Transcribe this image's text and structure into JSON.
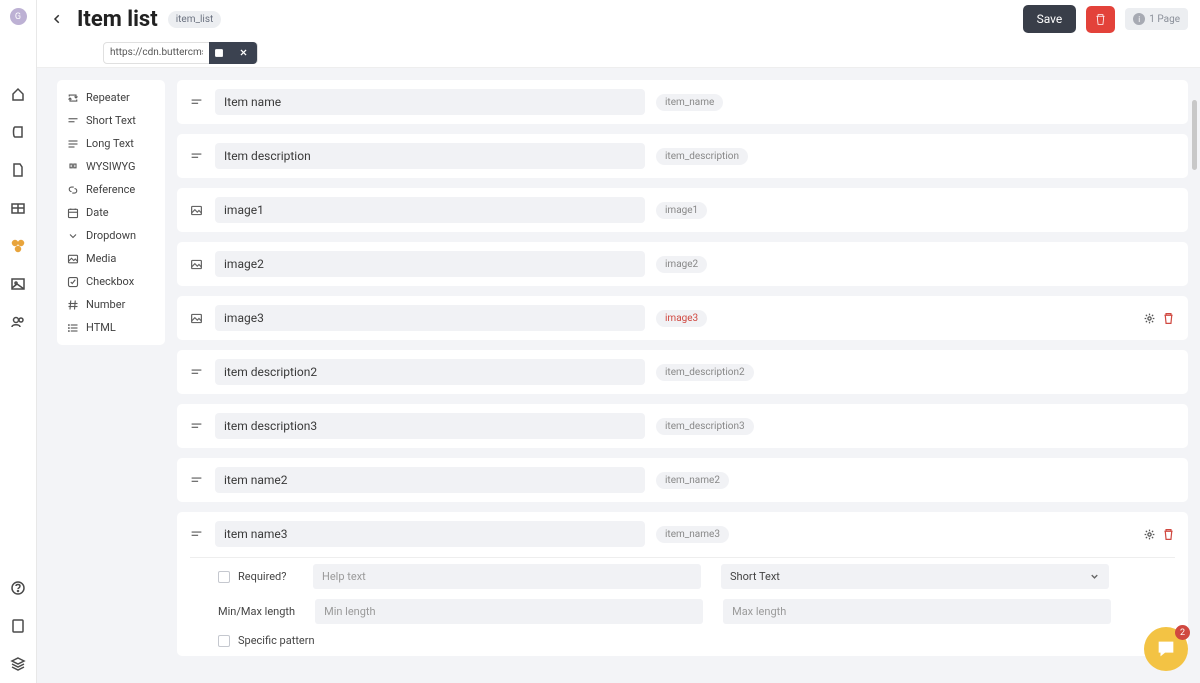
{
  "avatar_initial": "G",
  "header": {
    "title": "Item list",
    "slug": "item_list",
    "save_label": "Save",
    "page_info": "1 Page",
    "url_value": "https://cdn.buttercms."
  },
  "palette": [
    {
      "label": "Repeater",
      "icon": "repeat"
    },
    {
      "label": "Short Text",
      "icon": "short"
    },
    {
      "label": "Long Text",
      "icon": "long"
    },
    {
      "label": "WYSIWYG",
      "icon": "quote"
    },
    {
      "label": "Reference",
      "icon": "link"
    },
    {
      "label": "Date",
      "icon": "cal"
    },
    {
      "label": "Dropdown",
      "icon": "chev"
    },
    {
      "label": "Media",
      "icon": "img"
    },
    {
      "label": "Checkbox",
      "icon": "check"
    },
    {
      "label": "Number",
      "icon": "hash"
    },
    {
      "label": "HTML",
      "icon": "list"
    }
  ],
  "fields": [
    {
      "name": "Item name",
      "slug": "item_name",
      "type": "short"
    },
    {
      "name": "Item description",
      "slug": "item_description",
      "type": "short"
    },
    {
      "name": "image1",
      "slug": "image1",
      "type": "img"
    },
    {
      "name": "image2",
      "slug": "image2",
      "type": "img"
    },
    {
      "name": "image3",
      "slug": "image3",
      "type": "img",
      "active": true,
      "show_actions": true
    },
    {
      "name": "item description2",
      "slug": "item_description2",
      "type": "short"
    },
    {
      "name": "item description3",
      "slug": "item_description3",
      "type": "short"
    },
    {
      "name": "item name2",
      "slug": "item_name2",
      "type": "short"
    },
    {
      "name": "item name3",
      "slug": "item_name3",
      "type": "short",
      "show_actions": true,
      "expanded": true
    }
  ],
  "expand": {
    "required_label": "Required?",
    "help_placeholder": "Help text",
    "type_value": "Short Text",
    "minmax_label": "Min/Max length",
    "min_placeholder": "Min length",
    "max_placeholder": "Max length",
    "pattern_label": "Specific pattern"
  },
  "chat_badge": "2"
}
